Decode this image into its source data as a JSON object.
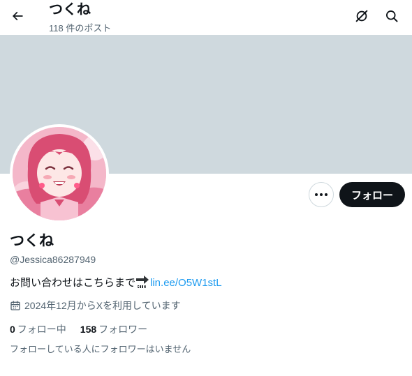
{
  "header": {
    "title": "つくね",
    "post_count": "118 件のポスト",
    "back_icon": "arrow-left-icon",
    "icons": [
      "grok-icon",
      "search-icon"
    ]
  },
  "profile": {
    "display_name": "つくね",
    "handle": "@Jessica86287949",
    "bio_text": "お問い合わせはこちらまで",
    "bio_emoji": "soon-arrow-icon",
    "bio_link": "lin.ee/O5W1stL",
    "joined": "2024年12月からXを利用しています",
    "follow_button": "フォロー"
  },
  "stats": {
    "following_count": "0",
    "following_label": "フォロー中",
    "followers_count": "158",
    "followers_label": "フォロワー"
  },
  "followers_note": "フォローしている人にフォロワーはいません",
  "colors": {
    "banner": "#cfd9de",
    "link": "#1d9bf0",
    "secondary_text": "#536471",
    "primary_text": "#0f1419"
  }
}
